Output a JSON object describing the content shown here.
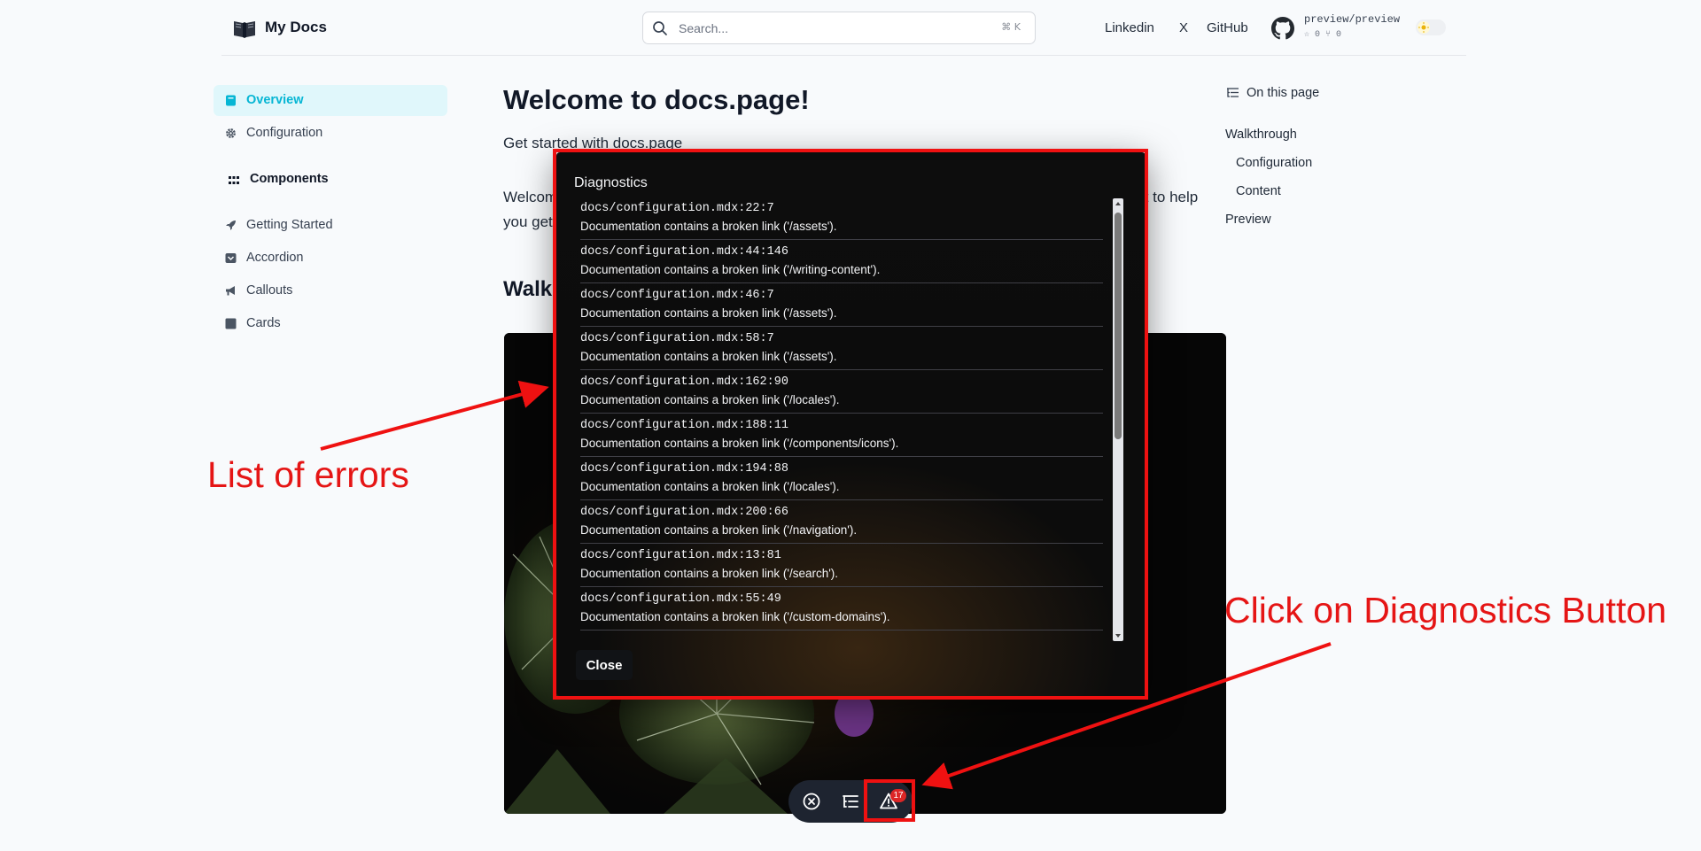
{
  "header": {
    "brand": "My Docs",
    "search_placeholder": "Search...",
    "search_shortcut": "⌘ K",
    "links": [
      "Linkedin",
      "X",
      "GitHub"
    ],
    "repo_name": "preview/preview",
    "repo_stats": "☆ 0  ⑂ 0"
  },
  "sidebar": {
    "items": [
      {
        "label": "Overview",
        "icon": "book-icon"
      },
      {
        "label": "Configuration",
        "icon": "gear-icon"
      }
    ],
    "group_heading": "Components",
    "group_items": [
      {
        "label": "Getting Started",
        "icon": "rocket-icon"
      },
      {
        "label": "Accordion",
        "icon": "inbox-icon"
      },
      {
        "label": "Callouts",
        "icon": "megaphone-icon"
      },
      {
        "label": "Cards",
        "icon": "square-icon"
      }
    ]
  },
  "main": {
    "title": "Welcome to docs.page!",
    "subtitle": "Get started with docs.page",
    "intro_line1_start": "Welcom",
    "intro_line1_end": "ject to help",
    "intro_line2_start": "you get",
    "walkthrough_heading_fragment": "Walk"
  },
  "toc": {
    "title": "On this page",
    "items": [
      {
        "label": "Walkthrough",
        "level": 1
      },
      {
        "label": "Configuration",
        "level": 2
      },
      {
        "label": "Content",
        "level": 2
      },
      {
        "label": "Preview",
        "level": 1
      }
    ]
  },
  "modal": {
    "title": "Diagnostics",
    "close_label": "Close",
    "diagnostics": [
      {
        "path": "docs/configuration.mdx:22:7",
        "message": "Documentation contains a broken link ('/assets')."
      },
      {
        "path": "docs/configuration.mdx:44:146",
        "message": "Documentation contains a broken link ('/writing-content')."
      },
      {
        "path": "docs/configuration.mdx:46:7",
        "message": "Documentation contains a broken link ('/assets')."
      },
      {
        "path": "docs/configuration.mdx:58:7",
        "message": "Documentation contains a broken link ('/assets')."
      },
      {
        "path": "docs/configuration.mdx:162:90",
        "message": "Documentation contains a broken link ('/locales')."
      },
      {
        "path": "docs/configuration.mdx:188:11",
        "message": "Documentation contains a broken link ('/components/icons')."
      },
      {
        "path": "docs/configuration.mdx:194:88",
        "message": "Documentation contains a broken link ('/locales')."
      },
      {
        "path": "docs/configuration.mdx:200:66",
        "message": "Documentation contains a broken link ('/navigation')."
      },
      {
        "path": "docs/configuration.mdx:13:81",
        "message": "Documentation contains a broken link ('/search')."
      },
      {
        "path": "docs/configuration.mdx:55:49",
        "message": "Documentation contains a broken link ('/custom-domains')."
      }
    ]
  },
  "toolbar": {
    "diagnostics_count": "17"
  },
  "annotations": {
    "list_label": "List of errors",
    "click_label": "Click on Diagnostics Button",
    "color": "#ef1111"
  }
}
